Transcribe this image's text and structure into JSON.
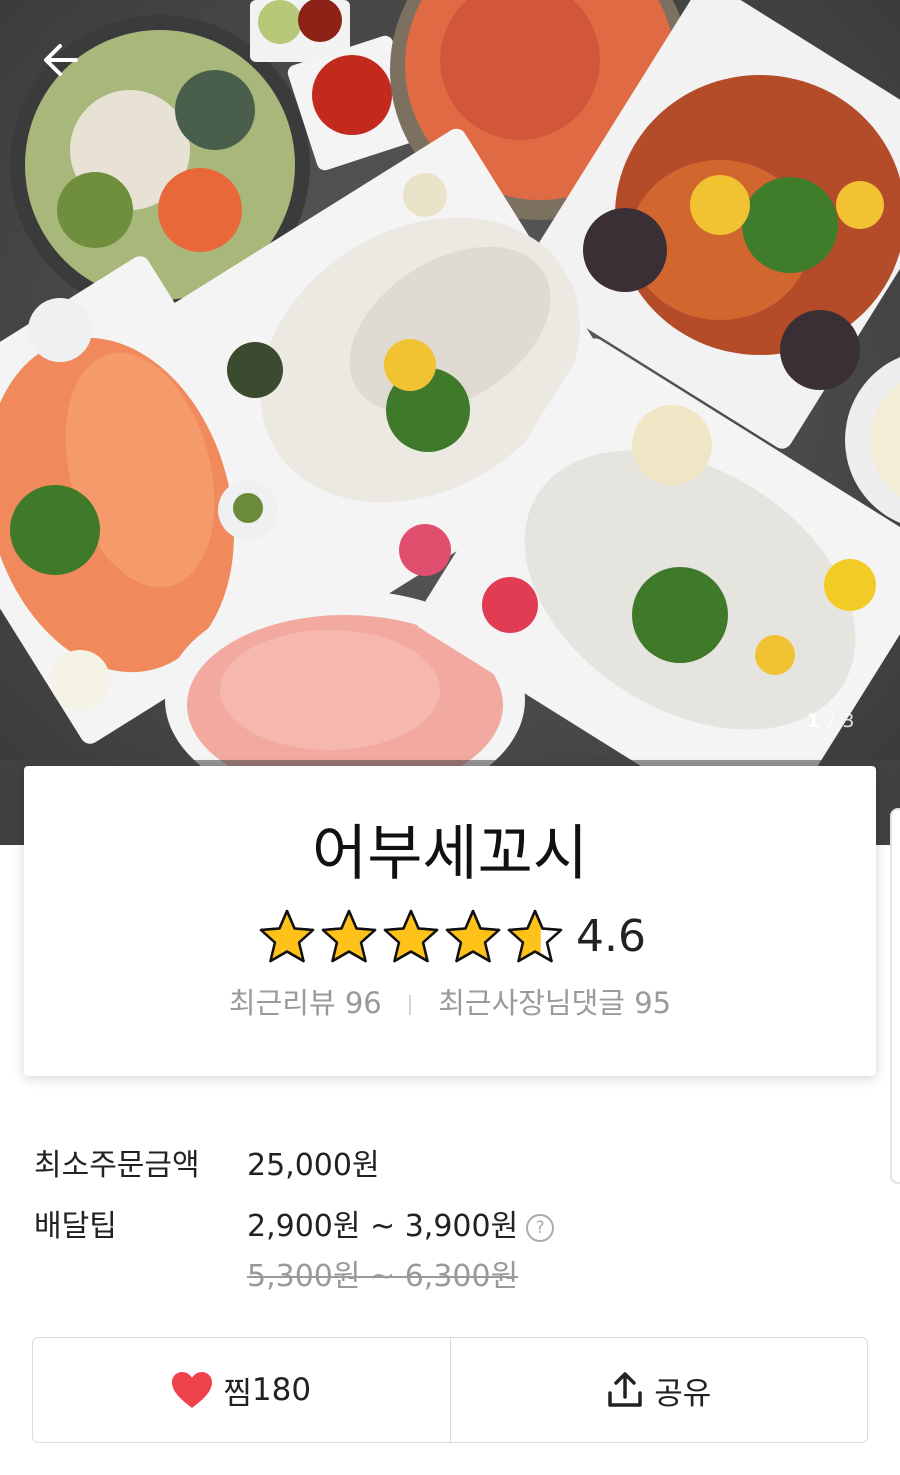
{
  "header": {
    "counter_current": "1",
    "counter_separator": "/",
    "counter_total": "3"
  },
  "store": {
    "name": "어부세꼬시",
    "rating": "4.6",
    "rating_value": 4.6,
    "recent_reviews_label": "최근리뷰",
    "recent_reviews_count": "96",
    "owner_comments_label": "최근사장님댓글",
    "owner_comments_count": "95"
  },
  "delivery": {
    "min_order_label": "최소주문금액",
    "min_order_value": "25,000원",
    "tip_label": "배달팁",
    "tip_value": "2,900원 ~ 3,900원",
    "tip_original": "5,300원 ~ 6,300원",
    "help_symbol": "?"
  },
  "actions": {
    "like_label": "찜",
    "like_count": "180",
    "share_label": "공유"
  },
  "colors": {
    "star_fill": "#FFC21A",
    "heart": "#F0424D",
    "muted_text": "#9A9A9A"
  },
  "icons": [
    "back-arrow-icon",
    "star-icon",
    "help-icon",
    "heart-icon",
    "share-icon"
  ]
}
